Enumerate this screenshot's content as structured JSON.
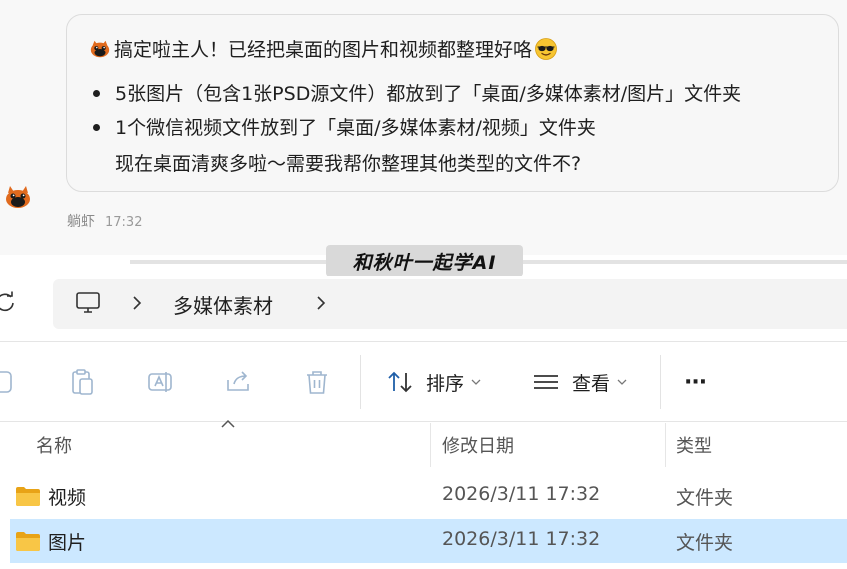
{
  "chat": {
    "message_line1": "搞定啦主人！已经把桌面的图片和视频都整理好咯",
    "bullets": [
      "5张图片（包含1张PSD源文件）都放到了「桌面/多媒体素材/图片」文件夹",
      "1个微信视频文件放到了「桌面/多媒体素材/视频」文件夹"
    ],
    "message_line4": "现在桌面清爽多啦～需要我帮你整理其他类型的文件不?",
    "sender_name": "躺虾",
    "time": "17:32"
  },
  "watermark": "和秋叶一起学AI",
  "explorer": {
    "breadcrumb": "多媒体素材",
    "toolbar": {
      "sort_label": "排序",
      "view_label": "查看",
      "more_label": "···"
    },
    "columns": {
      "name": "名称",
      "date": "修改日期",
      "type": "类型"
    },
    "rows": [
      {
        "name": "视频",
        "date": "2026/3/11 17:32",
        "type": "文件夹"
      },
      {
        "name": "图片",
        "date": "2026/3/11 17:32",
        "type": "文件夹"
      }
    ]
  },
  "colors": {
    "selection": "#cce8ff",
    "folder": "#f5c443",
    "chat_bg": "#f8f8f8"
  },
  "icons": [
    "fox-emoji-icon",
    "sunglasses-emoji-icon",
    "refresh-icon",
    "this-pc-icon",
    "chevron-right-icon",
    "folder-icon",
    "sort-icon",
    "view-icon",
    "more-icon"
  ]
}
